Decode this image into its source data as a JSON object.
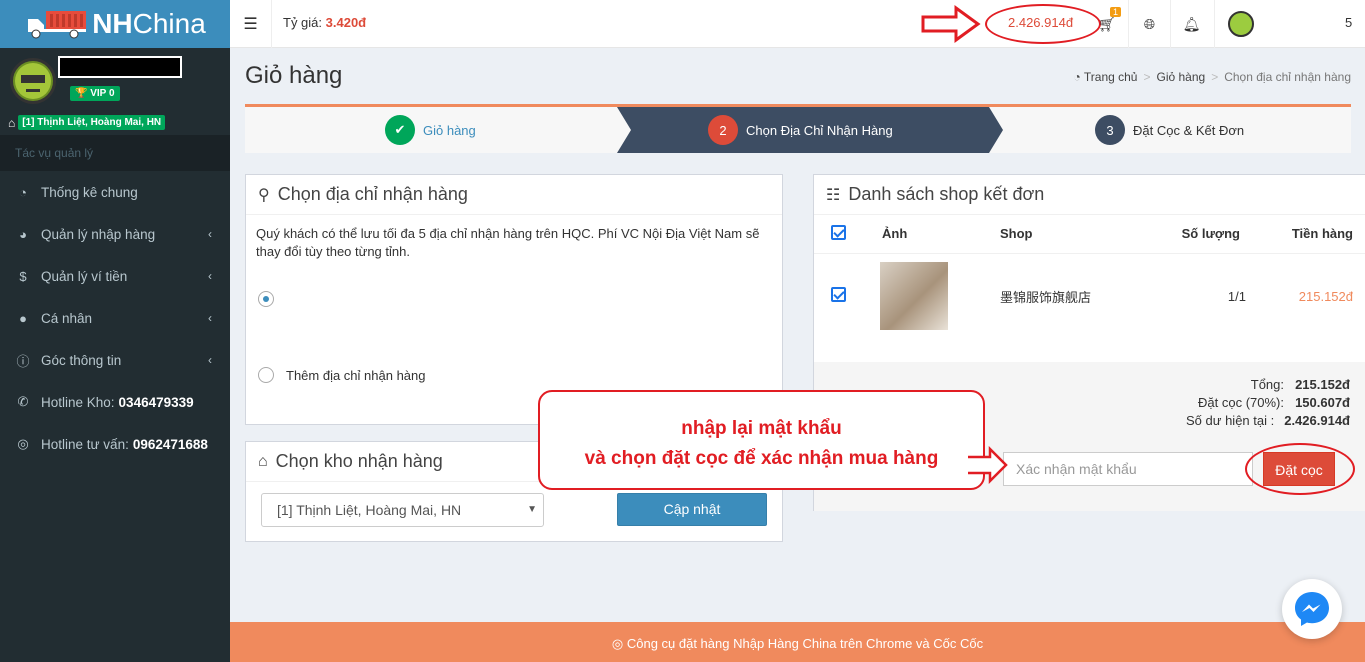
{
  "brand": {
    "nh": "NH",
    "china": "China"
  },
  "user": {
    "vip": "VIP 0",
    "address_badge": "[1] Thịnh Liệt, Hoàng Mai, HN"
  },
  "sidebar": {
    "section_header": "Tác vụ quản lý",
    "items": [
      {
        "label": "Thống kê chung",
        "icon": "dashboard-icon"
      },
      {
        "label": "Quản lý nhập hàng",
        "icon": "pie-chart-icon"
      },
      {
        "label": "Quản lý ví tiền",
        "icon": "dollar-icon"
      },
      {
        "label": "Cá nhân",
        "icon": "user-icon"
      },
      {
        "label": "Góc thông tin",
        "icon": "info-icon"
      },
      {
        "label": "Hotline Kho:",
        "value": "0346479339",
        "icon": "phone-icon"
      },
      {
        "label": "Hotline tư vấn:",
        "value": "0962471688",
        "icon": "support-icon"
      }
    ]
  },
  "topbar": {
    "rate_label": "Tỷ giá:",
    "rate_value": "3.420đ",
    "balance": "2.426.914đ",
    "cart_count": "1",
    "user_num": "5"
  },
  "page": {
    "title": "Giỏ hàng"
  },
  "breadcrumb": {
    "home": "Trang chủ",
    "cart": "Giỏ hàng",
    "current": "Chọn địa chỉ nhận hàng"
  },
  "steps": [
    {
      "num": "✔",
      "label": "Giỏ hàng"
    },
    {
      "num": "2",
      "label": "Chọn Địa Chỉ Nhận Hàng"
    },
    {
      "num": "3",
      "label": "Đặt Cọc & Kết Đơn"
    }
  ],
  "address_box": {
    "title": "Chọn địa chỉ nhận hàng",
    "note": "Quý khách có thể lưu tối đa 5 địa chỉ nhận hàng trên HQC. Phí VC Nội Địa Việt Nam sẽ thay đổi tùy theo từng tỉnh.",
    "add_label": "Thêm địa chỉ nhận hàng"
  },
  "warehouse_box": {
    "title": "Chọn kho nhận hàng",
    "selected": "[1] Thịnh Liệt, Hoàng Mai, HN",
    "update_button": "Cập nhật"
  },
  "shop_box": {
    "title": "Danh sách shop kết đơn",
    "columns": [
      "Ảnh",
      "Shop",
      "Số lượng",
      "Tiền hàng"
    ],
    "rows": [
      {
        "shop": "墨锦服饰旗舰店",
        "qty": "1/1",
        "amount": "215.152đ"
      }
    ],
    "summary": [
      {
        "label": "Tổng:",
        "value": "215.152đ"
      },
      {
        "label": "Đặt cọc (70%):",
        "value": "150.607đ"
      },
      {
        "label": "Số dư hiện tại :",
        "value": "2.426.914đ"
      }
    ],
    "password_placeholder": "Xác nhận mật khẩu",
    "deposit_button": "Đặt cọc"
  },
  "callout": {
    "line1": "nhập lại mật khẩu",
    "line2": "và chọn đặt cọc để xác nhận mua hàng"
  },
  "footer": {
    "text": "Công cụ đặt hàng Nhập Hàng China trên Chrome và Cốc Cốc"
  },
  "colors": {
    "accent": "#3c8dbc",
    "danger": "#dd4b39",
    "footer": "#f08a5d",
    "sidebar": "#222d32"
  }
}
